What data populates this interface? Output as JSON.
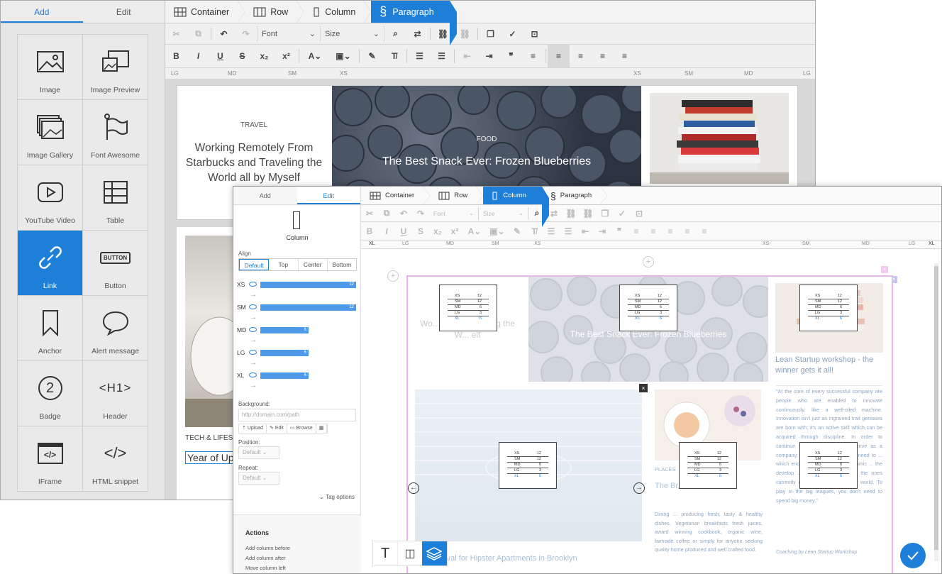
{
  "back": {
    "tabs": [
      "Add",
      "Edit"
    ],
    "tiles": [
      {
        "label": "Image",
        "icon": "image-icon"
      },
      {
        "label": "Image Preview",
        "icon": "image-preview-icon"
      },
      {
        "label": "Image Gallery",
        "icon": "image-gallery-icon"
      },
      {
        "label": "Font Awesome",
        "icon": "flag-icon"
      },
      {
        "label": "YouTube Video",
        "icon": "youtube-icon"
      },
      {
        "label": "Table",
        "icon": "table-icon"
      },
      {
        "label": "Link",
        "icon": "link-icon"
      },
      {
        "label": "Button",
        "icon": "button-icon",
        "text": "BUTTON"
      },
      {
        "label": "Anchor",
        "icon": "bookmark-icon"
      },
      {
        "label": "Alert message",
        "icon": "speech-bubble-icon"
      },
      {
        "label": "Badge",
        "icon": "badge-icon",
        "text": "2"
      },
      {
        "label": "Header",
        "icon": "header-icon",
        "text": "<H1>"
      },
      {
        "label": "IFrame",
        "icon": "iframe-icon",
        "text": "</>"
      },
      {
        "label": "HTML snippet",
        "icon": "code-icon",
        "text": "</>"
      }
    ],
    "crumbs": [
      "Container",
      "Row",
      "Column",
      "Paragraph"
    ],
    "font_label": "Font",
    "size_label": "Size",
    "ruler": [
      "LG",
      "MD",
      "SM",
      "XS",
      "XS",
      "SM",
      "MD",
      "LG"
    ],
    "travel": {
      "category": "TRAVEL",
      "title": "Working Remotely From Starbucks and Traveling the World all by Myself"
    },
    "food": {
      "category": "FOOD",
      "title": "The Best Snack Ever: Frozen Blueberries"
    },
    "tech": {
      "category": "TECH & LIFESTY",
      "title": "Year of Up"
    }
  },
  "front": {
    "tabs": [
      "Add",
      "Edit"
    ],
    "crumbs": [
      "Container",
      "Row",
      "Column",
      "Paragraph"
    ],
    "font_label": "Font",
    "size_label": "Size",
    "ruler": [
      "XL",
      "LG",
      "MD",
      "SM",
      "XS",
      "XS",
      "SM",
      "MD",
      "LG",
      "XL"
    ],
    "column_label": "Column",
    "align_label": "Align",
    "align_options": [
      "Default",
      "Top",
      "Center",
      "Bottom"
    ],
    "breakpoints": [
      {
        "name": "XS",
        "value": "12",
        "fraction": 1.0
      },
      {
        "name": "SM",
        "value": "12",
        "fraction": 1.0
      },
      {
        "name": "MD",
        "value": "6",
        "fraction": 0.5
      },
      {
        "name": "LG",
        "value": "6",
        "fraction": 0.5
      },
      {
        "name": "XL",
        "value": "6",
        "fraction": 0.5
      }
    ],
    "background_label": "Background:",
    "background_placeholder": "http://domain.com/path",
    "bg_buttons": [
      "Upload",
      "Edit",
      "Browse"
    ],
    "position_label": "Position:",
    "position_value": "Default",
    "repeat_label": "Repeat:",
    "repeat_value": "Default",
    "tag_options": "Tag options",
    "actions_title": "Actions",
    "actions": [
      "Add column before",
      "Add column after",
      "Move column left"
    ],
    "canvas": {
      "food_title": "The Best Snack Ever: Frozen Blueberries",
      "lean_title": "Lean Startup workshop - the winner gets it all!",
      "places": "PLACES",
      "places_title": "The Br... Soon i...",
      "places_body": "Dining ... producing fresh, tasty & healthy dishes. Vegetarian breakfasts fresh juices, award winning cookbook, organic wine, fairtrade coffee or simply for anyone seeking quality home produced and well crafted food.",
      "quote": "\"At the core of every successful company are people who are enabled to innovate continuously, like a well-oiled machine. Innovation isn't just an ingrained trait geniuses are born with; it's an active skill which can be acquired through discipline. In order to continue to grow, survive and thrive as a company, you have to ... that you need to ... which encourage ... creativity. Dynamic ... the develop ... and encourag ... are the ones currently dominating the business world. To play in the big leagues, you don't need to spend big money.\"",
      "quote_author": "Coaching by Lean Startup Workshop",
      "brooklyn": "... Upheaval for Hipster Apartments in Brooklyn",
      "left_ghost": "Wo... from Starbu... g the W... elf"
    },
    "mini_table": [
      [
        "XS",
        "12"
      ],
      [
        "SM",
        "12"
      ],
      [
        "MD",
        "6"
      ],
      [
        "LG",
        "3"
      ],
      [
        "XL",
        "6"
      ]
    ]
  }
}
